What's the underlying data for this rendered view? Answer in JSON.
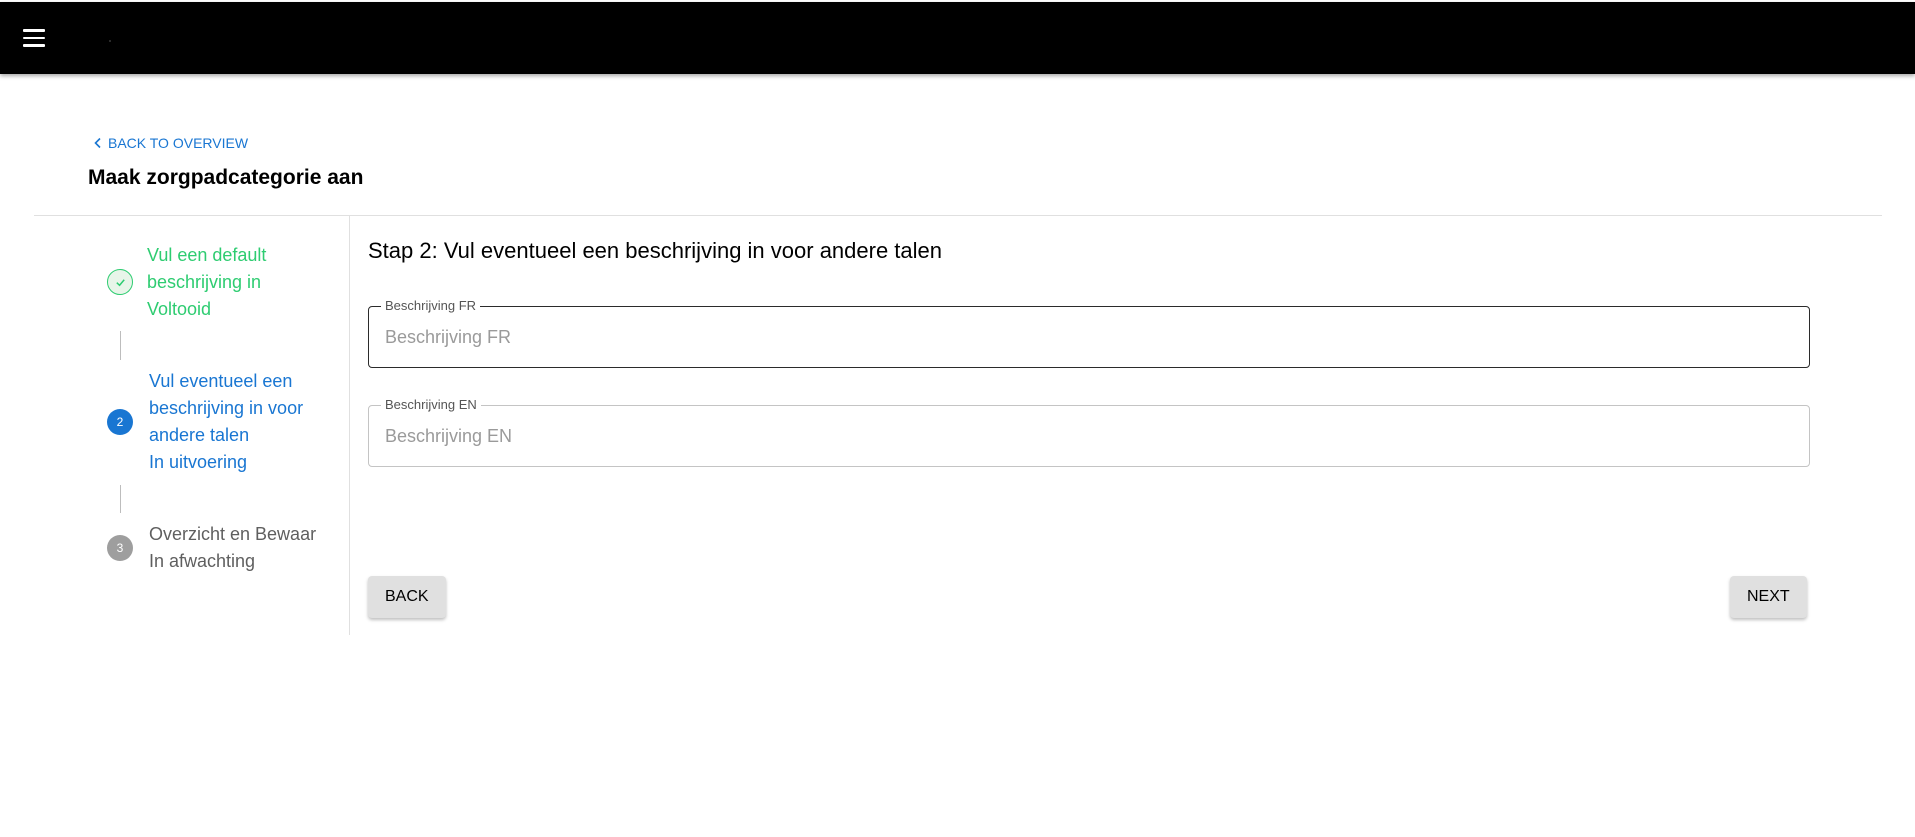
{
  "header": {
    "menu_icon": "menu-icon"
  },
  "nav": {
    "back_label": "BACK TO OVERVIEW",
    "back_icon": "chevron-left-icon"
  },
  "page": {
    "title": "Maak zorgpadcategorie aan"
  },
  "stepper": {
    "steps": [
      {
        "label_lines": [
          "Vul een default",
          "beschrijving in"
        ],
        "status": "Voltooid",
        "state": "completed",
        "icon": "check-icon"
      },
      {
        "number": "2",
        "label_lines": [
          "Vul eventueel een",
          "beschrijving in voor",
          "andere talen"
        ],
        "status": "In uitvoering",
        "state": "active"
      },
      {
        "number": "3",
        "label_lines": [
          "Overzicht en Bewaar"
        ],
        "status": "In afwachting",
        "state": "pending"
      }
    ]
  },
  "form": {
    "heading": "Stap 2: Vul eventueel een beschrijving in voor andere talen",
    "fields": [
      {
        "label": "Beschrijving FR",
        "placeholder": "Beschrijving FR",
        "value": ""
      },
      {
        "label": "Beschrijving EN",
        "placeholder": "Beschrijving EN",
        "value": ""
      }
    ],
    "back_button": "BACK",
    "next_button": "NEXT"
  },
  "colors": {
    "topbar": "#000000",
    "primary": "#1976d2",
    "success": "#2ecc71",
    "pending": "#9e9e9e"
  }
}
